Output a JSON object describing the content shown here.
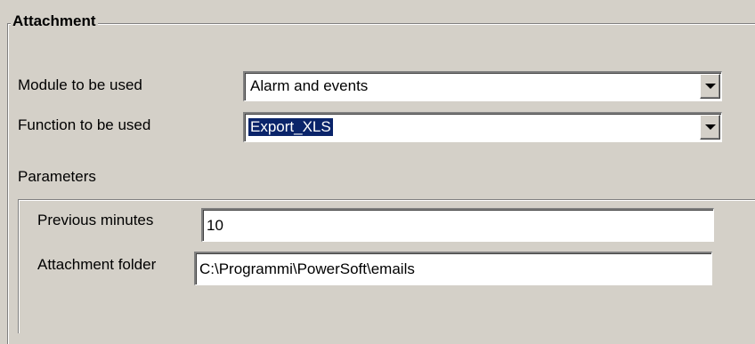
{
  "group": {
    "title": "Attachment"
  },
  "module": {
    "label": "Module to be used",
    "value": "Alarm and events"
  },
  "function": {
    "label": "Function to be used",
    "value": "Export_XLS"
  },
  "parameters": {
    "label": "Parameters",
    "fields": [
      {
        "label": "Previous minutes",
        "value": "10"
      },
      {
        "label": "Attachment folder",
        "value": "C:\\Programmi\\PowerSoft\\emails"
      }
    ]
  },
  "icons": {
    "dropdown": "chevron-down-icon"
  }
}
